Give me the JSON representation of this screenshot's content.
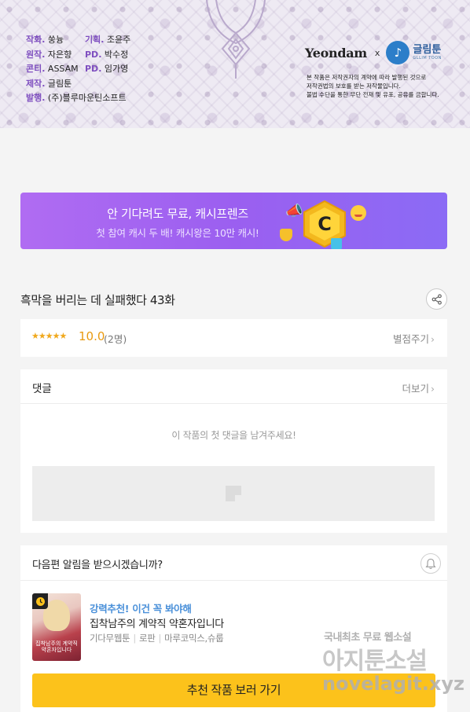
{
  "credits": {
    "left": [
      {
        "key": "작화.",
        "value": "쑹늉"
      },
      {
        "key": "원작.",
        "value": "자은향"
      },
      {
        "key": "콘티.",
        "value": "ASSAM"
      },
      {
        "key": "제작.",
        "value": "글림툰"
      },
      {
        "key": "발행.",
        "value": "(주)블루마운틴소프트"
      }
    ],
    "right": [
      {
        "key": "기획.",
        "value": "조윤주"
      },
      {
        "key": "PD.",
        "value": "박수정"
      },
      {
        "key": "PD.",
        "value": "임가영"
      }
    ],
    "brand_left": "Yeondam",
    "brand_x": "x",
    "brand_right": "글림툰",
    "brand_right_sub": "GLLIM TOON",
    "notice_lines": [
      "본 작품은 저작권자의 계약에 따라 발행된 것으로",
      "저작권법의 보호를 받는 저작물입니다.",
      "불법 수단을 통한 무단 전재 및 유포, 공유를 금합니다."
    ]
  },
  "promo": {
    "title": "안 기다려도 무료, 캐시프렌즈",
    "subtitle": "첫 참여 캐시 두 배! 캐시왕은 10만 캐시!",
    "coin_letter": "C"
  },
  "episode": {
    "title": "흑막을 버리는 데 실패했다 43화",
    "share_icon": "share-icon"
  },
  "rating": {
    "stars": "★★★★★",
    "score": "10.0",
    "count": "(2명)",
    "rate_link": "별점주기"
  },
  "comments": {
    "label": "댓글",
    "more": "더보기",
    "empty_message": "이 작품의 첫 댓글을 남겨주세요!"
  },
  "next_alert": {
    "question": "다음편 알림을 받으시겠습니까?",
    "bell_icon": "bell-icon"
  },
  "recommend": {
    "tag": "강력추천! 이건 꼭 봐야해",
    "title": "집착남주의 계약직 약혼자입니다",
    "meta": [
      "기다무웹툰",
      "로판",
      "마루코믹스,슈룹"
    ],
    "thumb_title": "집착남주의 계약직 약혼자입니다",
    "button": "추천 작품 보러 가기"
  },
  "watermark": {
    "line1": "국내최초 무료 웹소설",
    "line2": "아지툰소설",
    "line3": "novelagit.xyz"
  },
  "colors": {
    "accent_purple": "#9b5ff0",
    "credit_key": "#7f4fc0",
    "star": "#f0a81c",
    "button_yellow": "#fcc21b",
    "tag_blue": "#4a90d9"
  }
}
